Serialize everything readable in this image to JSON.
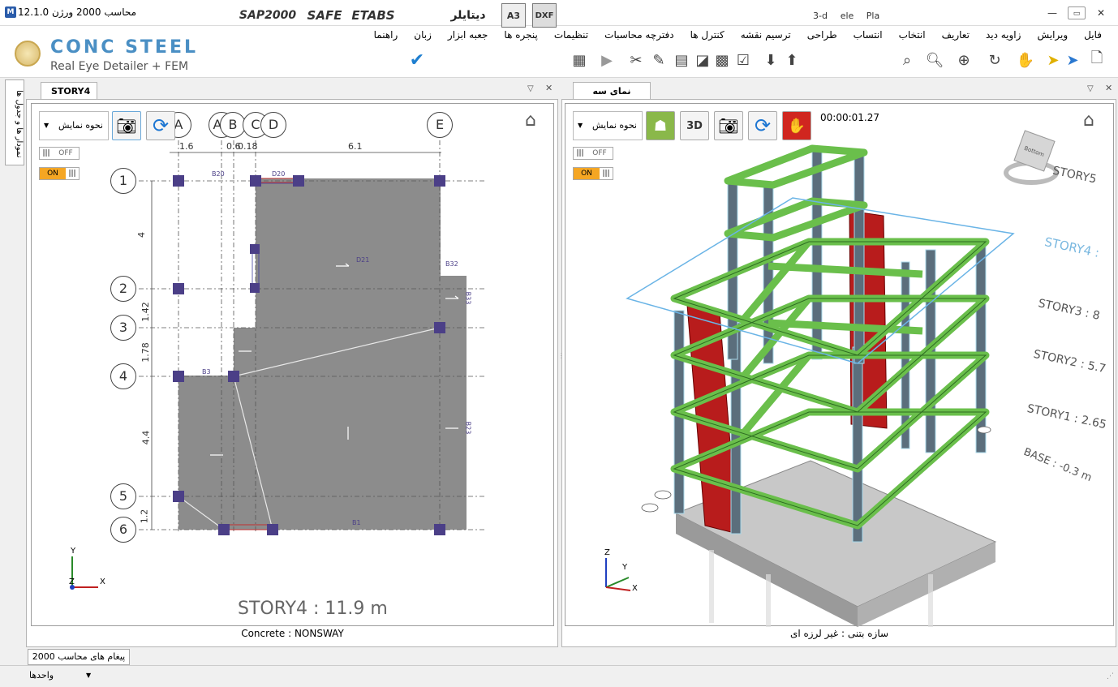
{
  "window": {
    "title": "محاسب 2000 ورژن 12.1.0",
    "minimize": "—",
    "restore": "▭",
    "close": "✕"
  },
  "menu": [
    "فایل",
    "ویرایش",
    "زاویه دید",
    "تعاریف",
    "انتخاب",
    "انتساب",
    "طراحی",
    "ترسیم نقشه",
    "کنترل ها",
    "دفترچه محاسبات",
    "تنظیمات",
    "پنجره ها",
    "جعبه ابزار",
    "زبان",
    "راهنما"
  ],
  "brand": {
    "name": "CONC STEEL",
    "subtitle": "Real Eye Detailer + FEM"
  },
  "toolbar": {
    "sap": "SAP2000",
    "safe": "SAFE",
    "etabs": "ETABS",
    "detailer": "دیتایلر",
    "a3": "A3",
    "dxf": "DXF",
    "view3d": "3-d",
    "elev": "ele",
    "plan": "Pla"
  },
  "side_tab": "نمودار ها و جدول ها",
  "left_pane": {
    "tab": "STORY4",
    "display_mode": "نحوه نمایش",
    "toggle_off": "OFF",
    "toggle_on": "ON",
    "grid_x": [
      "A",
      "A1",
      "B",
      "C",
      "D",
      "E"
    ],
    "grid_y": [
      "1",
      "2",
      "3",
      "4",
      "5",
      "6"
    ],
    "dims_x": [
      "1.6",
      "0.6",
      "0.6",
      "0.18",
      "6.1"
    ],
    "dims_y": [
      "4",
      "1.42",
      "1.78",
      "4.4",
      "1.2"
    ],
    "beams": [
      "B20",
      "D20",
      "D21",
      "B32",
      "B33",
      "B23",
      "B3",
      "B1"
    ],
    "footer_label": "STORY4 : 11.9 m",
    "status": "Concrete : NONSWAY",
    "axis_x": "X",
    "axis_y": "Y",
    "axis_z": "Z"
  },
  "right_pane": {
    "tab": "نمای سه بعدی",
    "display_mode": "نحوه نمایش",
    "toggle_off": "OFF",
    "toggle_on": "ON",
    "timer": "00:00:01.27",
    "btn_3d": "3D",
    "stories": [
      "STORY5",
      "STORY4 :",
      "STORY3 : 8",
      "STORY2 : 5.7",
      "STORY1 : 2.65",
      "BASE : -0.3 m"
    ],
    "status": "سازه بتنی : غیر لرزه ای",
    "axis_x": "X",
    "axis_y": "Y",
    "axis_z": "Z",
    "cube_label": "Bottom"
  },
  "messages_tab": "پیغام های محاسب 2000",
  "units_label": "واحدها",
  "colors": {
    "accent": "#4a8fc4",
    "slab": "#8a8a8a",
    "beam": "#6abf4b",
    "wall": "#c0201b",
    "column": "#4b3f87"
  }
}
